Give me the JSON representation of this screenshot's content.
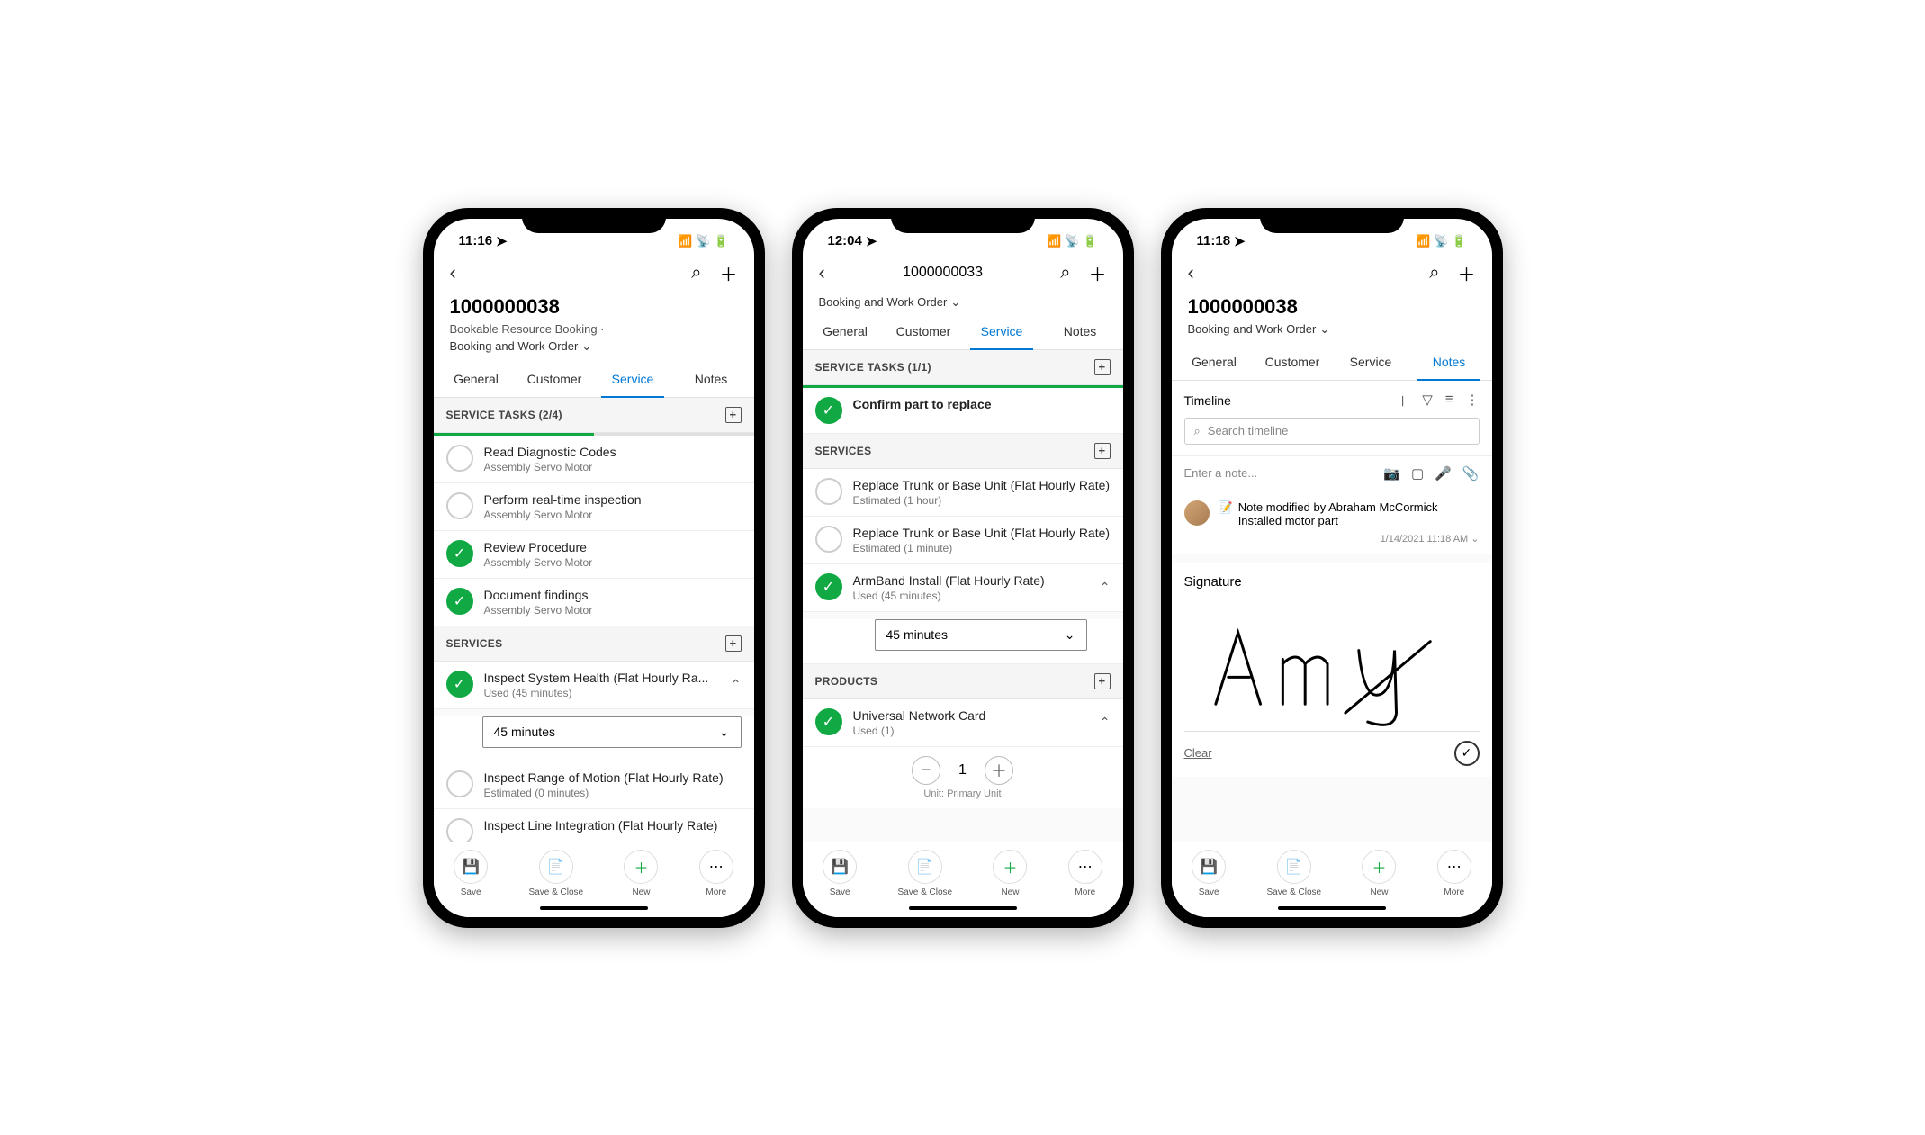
{
  "phones": [
    {
      "status_time": "11:16",
      "title": "1000000038",
      "subtitle": "Bookable Resource Booking  ·",
      "dropdown": "Booking and Work Order",
      "tabs": [
        "General",
        "Customer",
        "Service",
        "Notes"
      ],
      "active_tab": 2,
      "sections": {
        "service_tasks": {
          "header": "SERVICE TASKS (2/4)",
          "progress": 50,
          "items": [
            {
              "title": "Read Diagnostic Codes",
              "sub": "Assembly Servo Motor",
              "done": false
            },
            {
              "title": "Perform real-time inspection",
              "sub": "Assembly Servo Motor",
              "done": false
            },
            {
              "title": "Review Procedure",
              "sub": "Assembly Servo Motor",
              "done": true
            },
            {
              "title": "Document findings",
              "sub": "Assembly Servo Motor",
              "done": true
            }
          ]
        },
        "services": {
          "header": "SERVICES",
          "items": [
            {
              "title": "Inspect System Health (Flat Hourly Ra...",
              "sub": "Used (45 minutes)",
              "done": true,
              "expanded": true,
              "select_value": "45 minutes"
            },
            {
              "title": "Inspect Range of Motion (Flat Hourly Rate)",
              "sub": "Estimated (0 minutes)",
              "done": false
            },
            {
              "title": "Inspect Line Integration (Flat Hourly Rate)",
              "sub": "",
              "done": false
            }
          ]
        }
      }
    },
    {
      "status_time": "12:04",
      "header_title": "1000000033",
      "dropdown": "Booking and Work Order",
      "tabs": [
        "General",
        "Customer",
        "Service",
        "Notes"
      ],
      "active_tab": 2,
      "sections": {
        "service_tasks": {
          "header": "SERVICE TASKS (1/1)",
          "progress": 100,
          "items": [
            {
              "title": "Confirm part to replace",
              "done": true
            }
          ]
        },
        "services": {
          "header": "SERVICES",
          "items": [
            {
              "title": "Replace Trunk or Base Unit (Flat Hourly Rate)",
              "sub": "Estimated (1 hour)",
              "done": false
            },
            {
              "title": "Replace Trunk or Base Unit (Flat Hourly Rate)",
              "sub": "Estimated (1 minute)",
              "done": false
            },
            {
              "title": "ArmBand Install (Flat Hourly Rate)",
              "sub": "Used (45 minutes)",
              "done": true,
              "expanded": true,
              "select_value": "45 minutes"
            }
          ]
        },
        "products": {
          "header": "PRODUCTS",
          "items": [
            {
              "title": "Universal Network Card",
              "sub": "Used (1)",
              "done": true,
              "expanded": true,
              "qty": 1,
              "unit": "Unit: Primary Unit"
            }
          ]
        }
      }
    },
    {
      "status_time": "11:18",
      "title": "1000000038",
      "dropdown": "Booking and Work Order",
      "tabs": [
        "General",
        "Customer",
        "Service",
        "Notes"
      ],
      "active_tab": 3,
      "timeline": {
        "title": "Timeline",
        "search_placeholder": "Search timeline",
        "note_placeholder": "Enter a note...",
        "note_item": {
          "title": "Note modified by Abraham McCormick",
          "body": "Installed motor part",
          "date": "1/14/2021 11:18 AM"
        }
      },
      "signature": {
        "title": "Signature",
        "clear": "Clear"
      }
    }
  ],
  "footer": {
    "save": "Save",
    "save_close": "Save & Close",
    "new": "New",
    "more": "More"
  }
}
